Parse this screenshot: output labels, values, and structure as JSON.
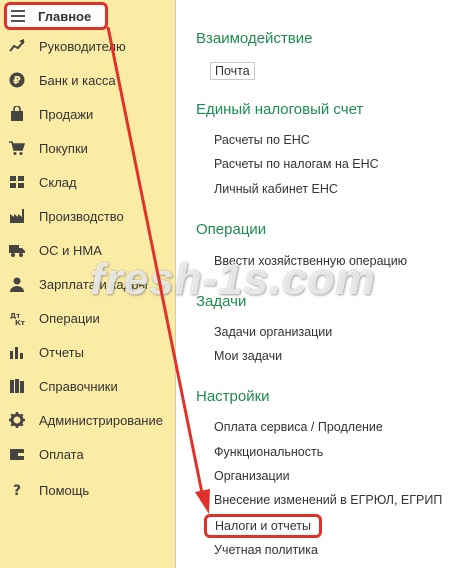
{
  "sidebar": {
    "items": [
      {
        "label": "Главное",
        "icon": "menu-icon"
      },
      {
        "label": "Руководителю",
        "icon": "chart-trend-icon"
      },
      {
        "label": "Банк и касса",
        "icon": "ruble-coin-icon"
      },
      {
        "label": "Продажи",
        "icon": "shopping-bag-icon"
      },
      {
        "label": "Покупки",
        "icon": "cart-icon"
      },
      {
        "label": "Склад",
        "icon": "warehouse-grid-icon"
      },
      {
        "label": "Производство",
        "icon": "factory-icon"
      },
      {
        "label": "ОС и НМА",
        "icon": "truck-icon"
      },
      {
        "label": "Зарплата и кадры",
        "icon": "person-icon"
      },
      {
        "label": "Операции",
        "icon": "dt-kt-icon"
      },
      {
        "label": "Отчеты",
        "icon": "bar-chart-icon"
      },
      {
        "label": "Справочники",
        "icon": "books-icon"
      },
      {
        "label": "Администрирование",
        "icon": "gear-icon"
      },
      {
        "label": "Оплата",
        "icon": "wallet-icon"
      },
      {
        "label": "Помощь",
        "icon": "question-icon"
      }
    ]
  },
  "sections": {
    "interaction": {
      "title": "Взаимодействие",
      "links": [
        "Почта"
      ]
    },
    "ens": {
      "title": "Единый налоговый счет",
      "links": [
        "Расчеты по ЕНС",
        "Расчеты по налогам на ЕНС",
        "Личный кабинет ЕНС"
      ]
    },
    "operations": {
      "title": "Операции",
      "links": [
        "Ввести хозяйственную операцию"
      ]
    },
    "tasks": {
      "title": "Задачи",
      "links": [
        "Задачи организации",
        "Мои задачи"
      ]
    },
    "settings": {
      "title": "Настройки",
      "links": [
        "Оплата сервиса / Продление",
        "Функциональность",
        "Организации",
        "Внесение изменений в ЕГРЮЛ, ЕГРИП",
        "Налоги и отчеты",
        "Учетная политика"
      ]
    }
  },
  "watermark": "fresh-1s.com",
  "colors": {
    "sidebar_bg": "#fbeca5",
    "section_title": "#1e8c51",
    "highlight": "#e0322a"
  }
}
